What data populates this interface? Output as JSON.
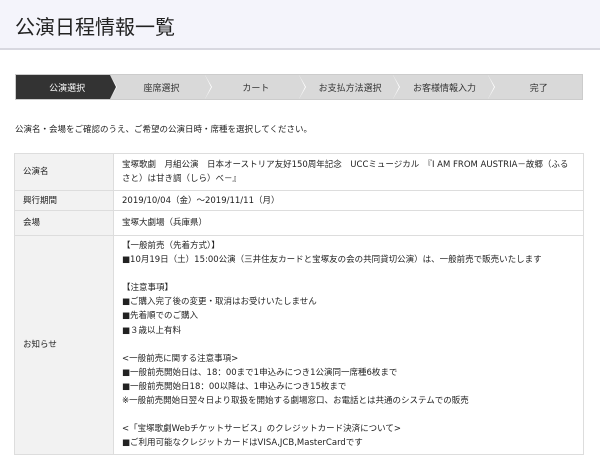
{
  "page_title": "公演日程情報一覧",
  "steps": [
    "公演選択",
    "座席選択",
    "カート",
    "お支払方法選択",
    "お客様情報入力",
    "完了"
  ],
  "active_step": 0,
  "instruction": "公演名・会場をご確認のうえ、ご希望の公演日時・席種を選択してください。",
  "table": {
    "rows": [
      {
        "label": "公演名",
        "value": "宝塚歌劇　月組公演　日本オーストリア友好150周年記念　UCCミュージカル　『I AM FROM AUSTRIA－故郷（ふるさと）は甘き調（しら）べ－』"
      },
      {
        "label": "興行期間",
        "value": "2019/10/04（金）～2019/11/11（月）"
      },
      {
        "label": "会場",
        "value": "宝塚大劇場（兵庫県）"
      },
      {
        "label": "お知らせ",
        "value": "【一般前売（先着方式）】\n■10月19日（土）15:00公演（三井住友カードと宝塚友の会の共同貸切公演）は、一般前売で販売いたします\n\n【注意事項】\n■ご購入完了後の変更・取消はお受けいたしません\n■先着順でのご購入\n■３歳以上有料\n\n<一般前売に関する注意事項>\n■一般前売開始日は、18：00まで1申込みにつき1公演同一席種6枚まで\n■一般前売開始日18：00以降は、1申込みにつき15枚まで\n※一般前売開始日翌々日より取扱を開始する劇場窓口、お電話とは共通のシステムでの販売\n\n<「宝塚歌劇Webチケットサービス」のクレジットカード決済について>\n■ご利用可能なクレジットカードはVISA,JCB,MasterCardです"
      }
    ]
  }
}
